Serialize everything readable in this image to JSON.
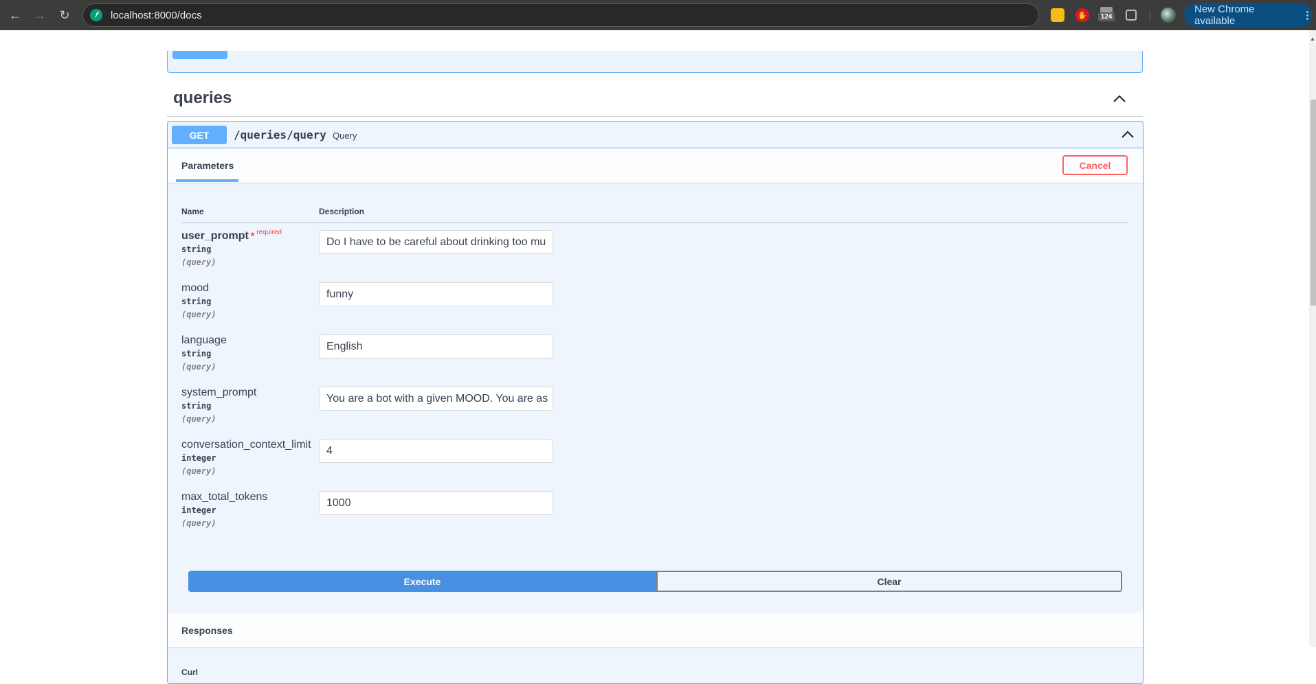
{
  "browser": {
    "url": "localhost:8000/docs",
    "extension_count_badge": "124",
    "update_button_label": "New Chrome available"
  },
  "tag": {
    "title": "queries"
  },
  "operation": {
    "method": "GET",
    "path": "/queries/query",
    "summary": "Query",
    "tab_label": "Parameters",
    "cancel_label": "Cancel",
    "columns": {
      "name": "Name",
      "description": "Description"
    },
    "required_label": "required",
    "required_star": "*",
    "parameters": [
      {
        "name": "user_prompt",
        "type": "string",
        "in": "(query)",
        "required": true,
        "value": "Do I have to be careful about drinking too mu"
      },
      {
        "name": "mood",
        "type": "string",
        "in": "(query)",
        "required": false,
        "value": "funny"
      },
      {
        "name": "language",
        "type": "string",
        "in": "(query)",
        "required": false,
        "value": "English"
      },
      {
        "name": "system_prompt",
        "type": "string",
        "in": "(query)",
        "required": false,
        "value": "You are a bot with a given MOOD. You are as"
      },
      {
        "name": "conversation_context_limit",
        "type": "integer",
        "in": "(query)",
        "required": false,
        "value": "4"
      },
      {
        "name": "max_total_tokens",
        "type": "integer",
        "in": "(query)",
        "required": false,
        "value": "1000"
      }
    ],
    "execute_label": "Execute",
    "clear_label": "Clear",
    "responses_title": "Responses",
    "curl_label": "Curl"
  },
  "colors": {
    "get_method": "#61affe",
    "execute": "#4990e2",
    "cancel": "#ff6060",
    "required": "#f93e3e",
    "text": "#3b4151"
  }
}
